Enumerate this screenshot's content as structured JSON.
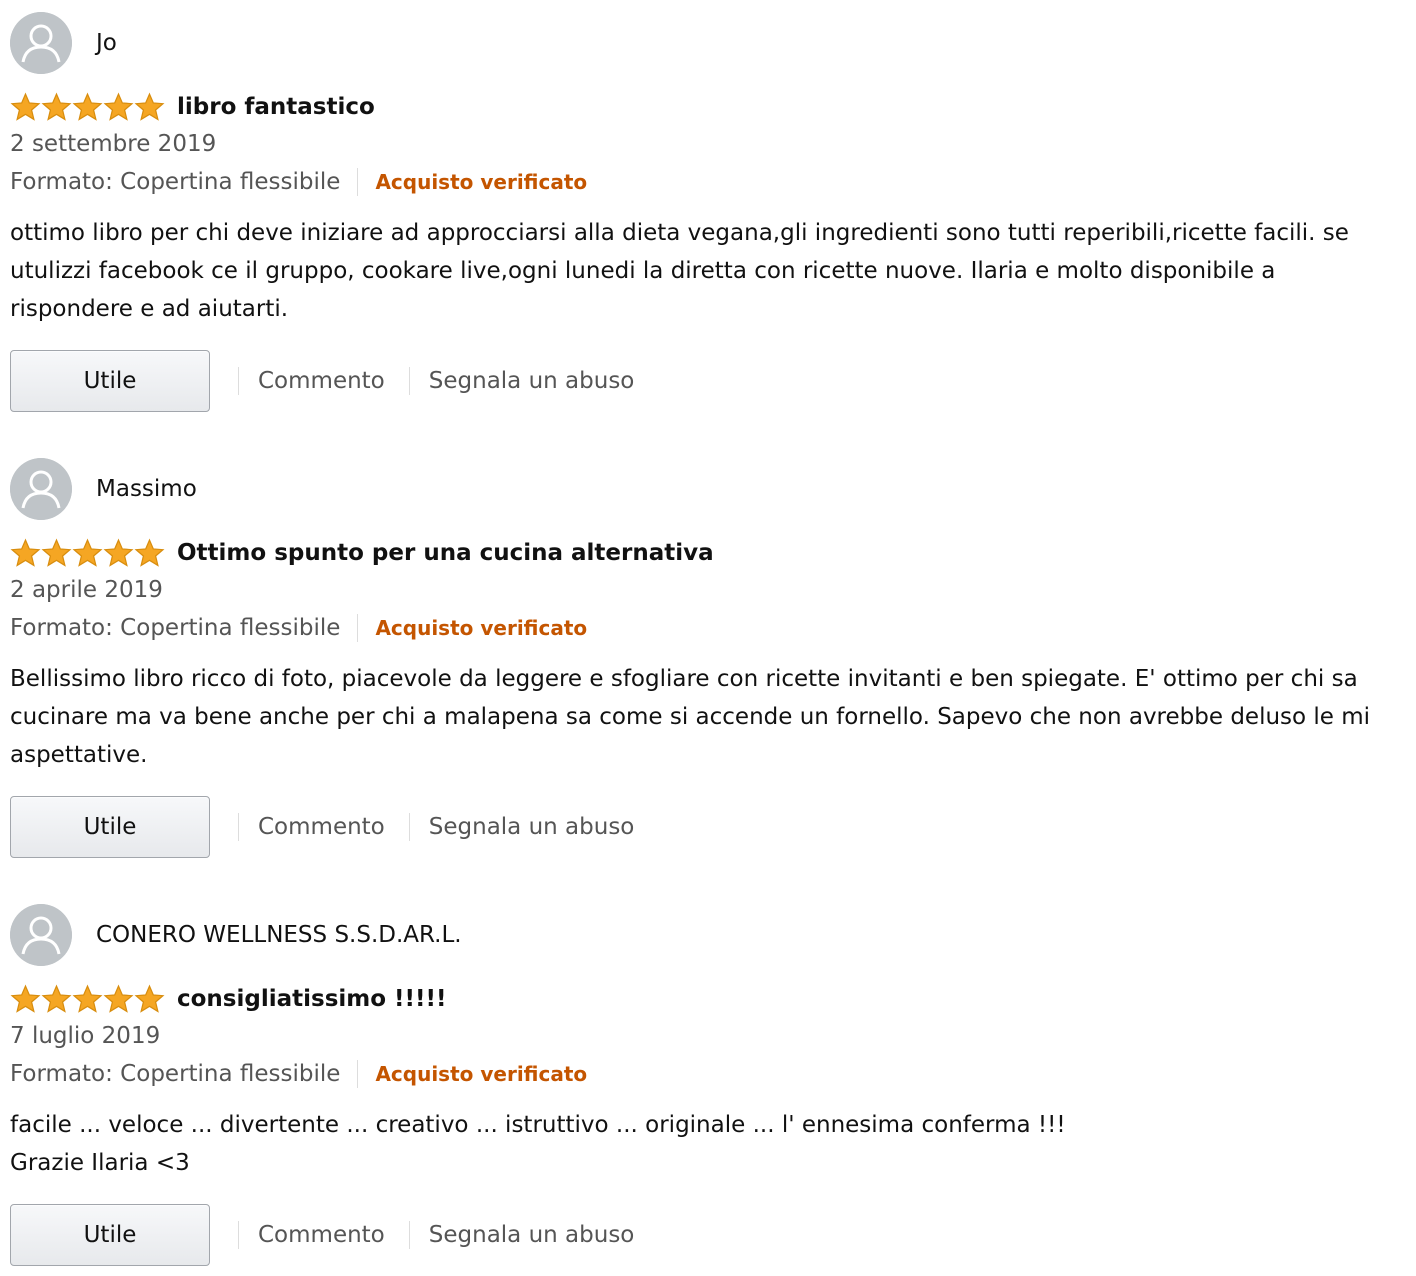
{
  "colors": {
    "star": "#f5a623",
    "verified": "#c45500",
    "muted_text": "#555555",
    "avatar_bg": "#bfc4c8"
  },
  "icons": {
    "avatar": "user-silhouette-icon",
    "star": "star-filled-icon"
  },
  "reviews": [
    {
      "author": "Jo",
      "rating": 5,
      "title": "libro fantastico",
      "date": "2 settembre 2019",
      "format": "Formato: Copertina flessibile",
      "verified": "Acquisto verificato",
      "body": "ottimo libro per chi deve iniziare ad approcciarsi alla dieta vegana,gli ingredienti sono tutti reperibili,ricette facili. se utulizzi facebook ce il gruppo, cookare live,ogni lunedi la diretta con ricette nuove. Ilaria e molto disponibile a rispondere e ad aiutarti.",
      "helpful_label": "Utile",
      "comment_label": "Commento",
      "report_label": "Segnala un abuso"
    },
    {
      "author": "Massimo",
      "rating": 5,
      "title": "Ottimo spunto per una cucina alternativa",
      "date": "2 aprile 2019",
      "format": "Formato: Copertina flessibile",
      "verified": "Acquisto verificato",
      "body": "Bellissimo libro ricco di foto, piacevole da leggere e sfogliare con ricette invitanti e ben spiegate. E' ottimo per chi sa cucinare ma va bene anche per chi a malapena sa come si accende un fornello. Sapevo che non avrebbe deluso le mi aspettative.",
      "helpful_label": "Utile",
      "comment_label": "Commento",
      "report_label": "Segnala un abuso"
    },
    {
      "author": "CONERO WELLNESS S.S.D.AR.L.",
      "rating": 5,
      "title": "consigliatissimo !!!!!",
      "date": "7 luglio 2019",
      "format": "Formato: Copertina flessibile",
      "verified": "Acquisto verificato",
      "body_lines": [
        "facile ... veloce ... divertente ... creativo ... istruttivo ... originale ... l' ennesima conferma !!!",
        "Grazie Ilaria <3"
      ],
      "helpful_label": "Utile",
      "comment_label": "Commento",
      "report_label": "Segnala un abuso"
    }
  ]
}
